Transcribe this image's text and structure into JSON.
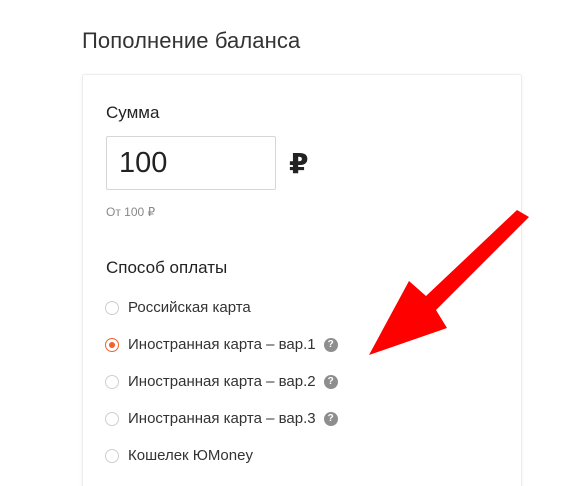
{
  "page": {
    "title": "Пополнение баланса"
  },
  "amount": {
    "label": "Сумма",
    "value": "100",
    "currency": "₽",
    "hint": "От 100 ₽"
  },
  "payment": {
    "label": "Способ оплаты",
    "selected_index": 1,
    "options": [
      {
        "label": "Российская карта",
        "has_help": false,
        "checked": false
      },
      {
        "label": "Иностранная карта – вар.1",
        "has_help": true,
        "checked": true
      },
      {
        "label": "Иностранная карта – вар.2",
        "has_help": true,
        "checked": false
      },
      {
        "label": "Иностранная карта – вар.3",
        "has_help": true,
        "checked": false
      },
      {
        "label": "Кошелек ЮMoney",
        "has_help": false,
        "checked": false
      }
    ],
    "help_glyph": "?"
  },
  "colors": {
    "accent": "#f2602c",
    "annotation_arrow": "#ff0000",
    "help_icon": "#8e8e8e"
  }
}
